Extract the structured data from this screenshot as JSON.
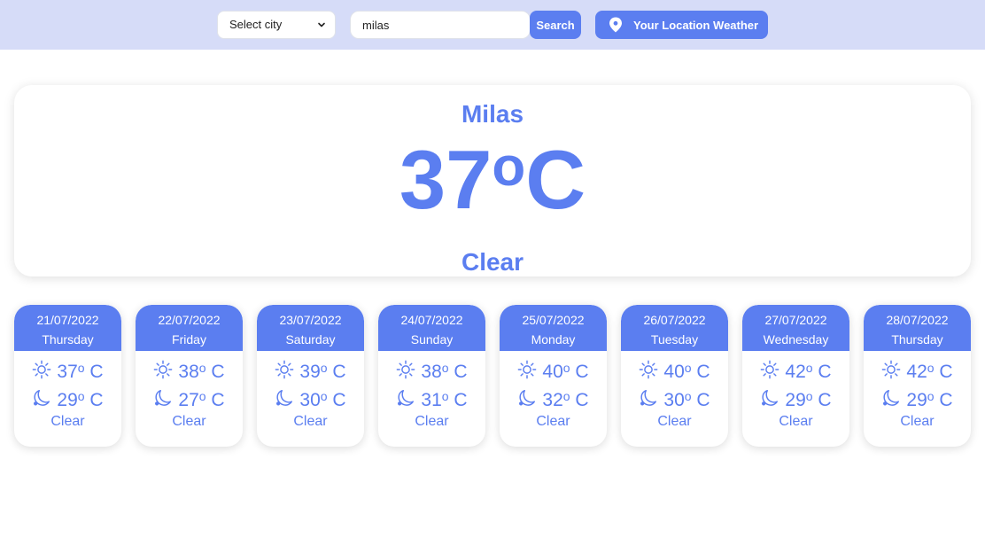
{
  "header": {
    "select_label": "Select city",
    "search_value": "milas",
    "search_button": "Search",
    "location_button": "Your Location Weather"
  },
  "current": {
    "city": "Milas",
    "temp_value": "37",
    "degree_sign": "o",
    "temp_unit": "C",
    "condition": "Clear"
  },
  "forecast": [
    {
      "date": "21/07/2022",
      "day": "Thursday",
      "high": "37",
      "low": "29",
      "unit_label": "o",
      "unit": "C",
      "condition": "Clear"
    },
    {
      "date": "22/07/2022",
      "day": "Friday",
      "high": "38",
      "low": "27",
      "unit_label": "o",
      "unit": "C",
      "condition": "Clear"
    },
    {
      "date": "23/07/2022",
      "day": "Saturday",
      "high": "39",
      "low": "30",
      "unit_label": "o",
      "unit": "C",
      "condition": "Clear"
    },
    {
      "date": "24/07/2022",
      "day": "Sunday",
      "high": "38",
      "low": "31",
      "unit_label": "o",
      "unit": "C",
      "condition": "Clear"
    },
    {
      "date": "25/07/2022",
      "day": "Monday",
      "high": "40",
      "low": "32",
      "unit_label": "o",
      "unit": "C",
      "condition": "Clear"
    },
    {
      "date": "26/07/2022",
      "day": "Tuesday",
      "high": "40",
      "low": "30",
      "unit_label": "o",
      "unit": "C",
      "condition": "Clear"
    },
    {
      "date": "27/07/2022",
      "day": "Wednesday",
      "high": "42",
      "low": "29",
      "unit_label": "o",
      "unit": "C",
      "condition": "Clear"
    },
    {
      "date": "28/07/2022",
      "day": "Thursday",
      "high": "42",
      "low": "29",
      "unit_label": "o",
      "unit": "C",
      "condition": "Clear"
    }
  ],
  "icons": {
    "sun": "sun-icon",
    "moon": "moon-icon",
    "pin": "location-pin-icon",
    "chevron": "chevron-down-icon"
  },
  "colors": {
    "accent": "#5b7ef0",
    "topbar": "#d6dcf8"
  }
}
